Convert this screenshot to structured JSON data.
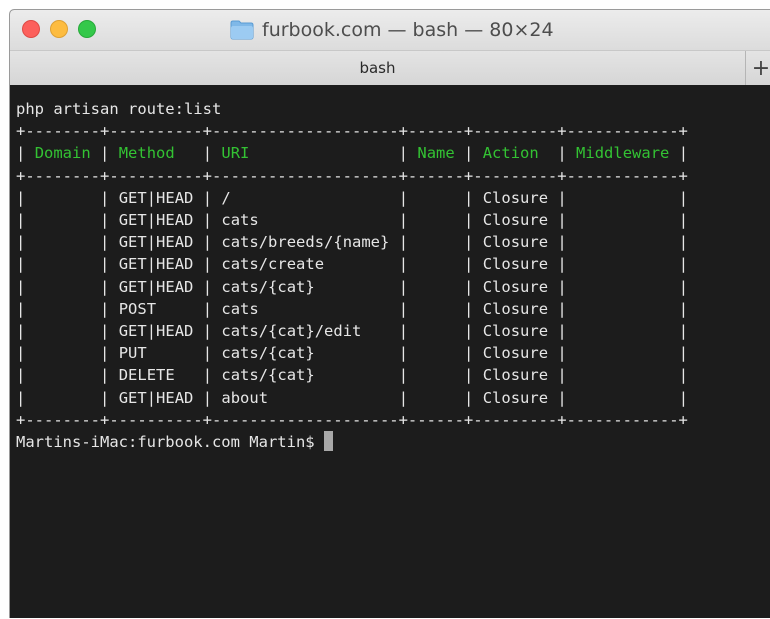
{
  "window": {
    "title": "furbook.com — bash — 80×24",
    "tab_label": "bash",
    "new_tab_label": "+"
  },
  "terminal": {
    "command": "php artisan route:list",
    "columns": [
      "Domain",
      "Method",
      "URI",
      "Name",
      "Action",
      "Middleware"
    ],
    "rows": [
      {
        "domain": "",
        "method": "GET|HEAD",
        "uri": "/",
        "name": "",
        "action": "Closure",
        "middleware": ""
      },
      {
        "domain": "",
        "method": "GET|HEAD",
        "uri": "cats",
        "name": "",
        "action": "Closure",
        "middleware": ""
      },
      {
        "domain": "",
        "method": "GET|HEAD",
        "uri": "cats/breeds/{name}",
        "name": "",
        "action": "Closure",
        "middleware": ""
      },
      {
        "domain": "",
        "method": "GET|HEAD",
        "uri": "cats/create",
        "name": "",
        "action": "Closure",
        "middleware": ""
      },
      {
        "domain": "",
        "method": "GET|HEAD",
        "uri": "cats/{cat}",
        "name": "",
        "action": "Closure",
        "middleware": ""
      },
      {
        "domain": "",
        "method": "POST",
        "uri": "cats",
        "name": "",
        "action": "Closure",
        "middleware": ""
      },
      {
        "domain": "",
        "method": "GET|HEAD",
        "uri": "cats/{cat}/edit",
        "name": "",
        "action": "Closure",
        "middleware": ""
      },
      {
        "domain": "",
        "method": "PUT",
        "uri": "cats/{cat}",
        "name": "",
        "action": "Closure",
        "middleware": ""
      },
      {
        "domain": "",
        "method": "DELETE",
        "uri": "cats/{cat}",
        "name": "",
        "action": "Closure",
        "middleware": ""
      },
      {
        "domain": "",
        "method": "GET|HEAD",
        "uri": "about",
        "name": "",
        "action": "Closure",
        "middleware": ""
      }
    ],
    "prompt": "Martins-iMac:furbook.com Martin$ "
  },
  "colors": {
    "header_text": "#33c233",
    "terminal_bg": "#1c1c1c",
    "terminal_text": "#e6e6e6"
  },
  "icons": {
    "title_icon": "folder-icon",
    "window_controls": [
      "close-icon",
      "minimize-icon",
      "zoom-icon"
    ]
  }
}
